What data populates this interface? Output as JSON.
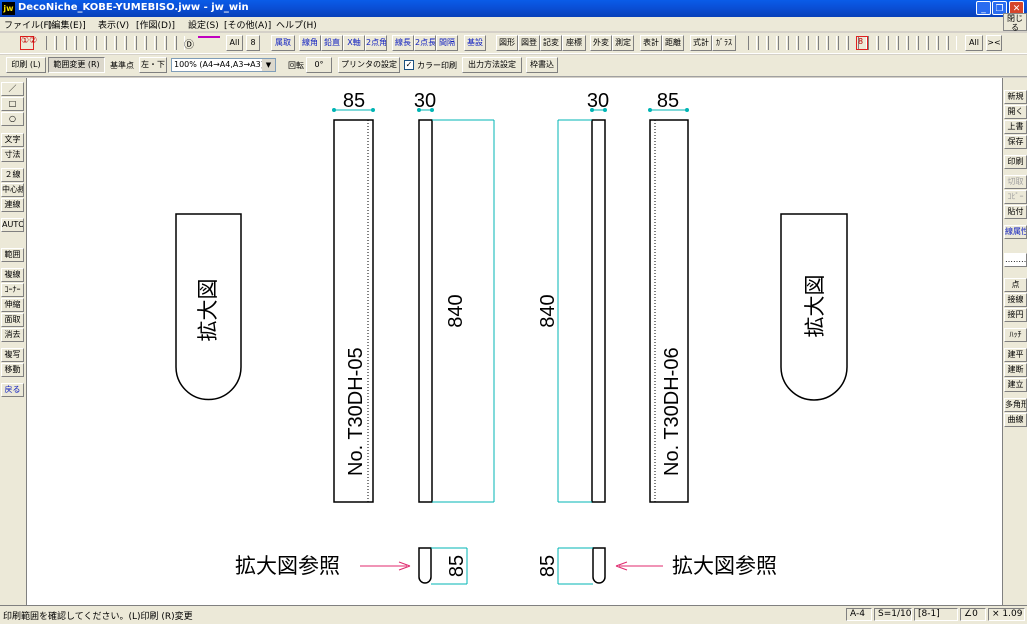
{
  "window": {
    "app_icon_text": "jw",
    "title": "DecoNiche_KOBE-YUMEBISO.jww - jw_win",
    "min_icon": "minimize-icon",
    "max_icon": "restore-icon",
    "close_icon": "close-icon"
  },
  "menu": {
    "items": [
      "ファイル(F)",
      "[編集(E)]",
      "表示(V)",
      "[作図(D)]",
      "設定(S)",
      "[その他(A)]",
      "ヘルプ(H)"
    ],
    "close_label": "閉じる"
  },
  "toolbar1": {
    "layer_group_label": "①②",
    "layer_d_label": "Ⓓ",
    "all_label": "All",
    "eight_label": "8",
    "buttons": [
      "属取",
      "線角",
      "鉛直",
      "X軸",
      "2点角",
      "線長",
      "2点長",
      "間隔",
      "基設",
      "図形",
      "図登",
      "記変",
      "座標",
      "外変",
      "測定",
      "表計",
      "距離",
      "式計",
      "ｶﾞﾗｽ"
    ],
    "right_eight": "8",
    "right_all": "All",
    "right_x": "><"
  },
  "toolbar2": {
    "print_label": "印刷 (L)",
    "range_label": "範囲変更 (R)",
    "basepoint_label": "基準点",
    "basepoint_value": "左・下",
    "scale_select": "100% (A4→A4,A3→A3)",
    "rotate_label": "回転",
    "rotate_value": "0°",
    "printer_label": "プリンタの設定",
    "color_print_label": "カラー印刷",
    "output_label": "出力方法設定",
    "frame_label": "枠書込"
  },
  "left_toolbar": {
    "items": [
      "／",
      "□",
      "○",
      "文字",
      "寸法",
      "２線",
      "中心線",
      "連線",
      "AUTO",
      "範囲",
      "複線",
      "ｺｰﾅｰ",
      "伸縮",
      "面取",
      "消去",
      "複写",
      "移動",
      "戻る"
    ]
  },
  "right_toolbar": {
    "items": [
      "新規",
      "開く",
      "上書",
      "保存",
      "印刷",
      "切取",
      "ｺﾋﾟｰ",
      "貼付",
      "線属性",
      "………",
      "点",
      "接線",
      "接円",
      "ﾊｯﾁ",
      "建平",
      "建断",
      "建立",
      "多角形",
      "曲線"
    ]
  },
  "drawing": {
    "dim_top_left_outer": "85",
    "dim_top_left_inner": "30",
    "dim_top_right_inner": "30",
    "dim_top_right_outer": "85",
    "dim_height_left": "840",
    "dim_height_right": "840",
    "part_label_left": "No. T30DH-05",
    "part_label_right": "No. T30DH-06",
    "detail_label_left": "拡大図",
    "detail_label_right": "拡大図",
    "ref_label_left": "拡大図参照",
    "ref_label_right": "拡大図参照",
    "dim_bottom_left": "85",
    "dim_bottom_right": "85"
  },
  "statusbar": {
    "message": "印刷範囲を確認してください。(L)印刷 (R)変更",
    "paper": "A-4",
    "scale": "S=1/10",
    "layer": "[8-1]",
    "angle": "∠0",
    "zoom": "× 1.09"
  },
  "colors": {
    "titlebar": "#0a4fd6",
    "dimension_line": "#00b4b4",
    "dimension_marker": "#00b4b4",
    "arrow": "#e0286e",
    "layer_mark": "#c000c0"
  }
}
